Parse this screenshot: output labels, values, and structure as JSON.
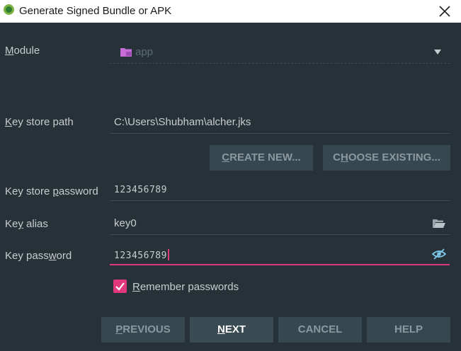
{
  "window": {
    "title": "Generate Signed Bundle or APK"
  },
  "form": {
    "module": {
      "label_pre": "",
      "label_mn": "M",
      "label_post": "odule",
      "value": "app"
    },
    "keystore_path": {
      "label_pre": "",
      "label_mn": "K",
      "label_post": "ey store path",
      "value": "C:\\Users\\Shubham\\alcher.jks"
    },
    "keystore_password": {
      "label_pre": "Key store ",
      "label_mn": "p",
      "label_post": "assword",
      "value": "123456789"
    },
    "key_alias": {
      "label_pre": "Ke",
      "label_mn": "y",
      "label_post": " alias",
      "value": "key0"
    },
    "key_password": {
      "label_pre": "Key pass",
      "label_mn": "w",
      "label_post": "ord",
      "value": "123456789"
    },
    "remember": {
      "label_pre": "",
      "label_mn": "R",
      "label_post": "emember passwords",
      "checked": true
    }
  },
  "buttons": {
    "create_new": {
      "mn": "C",
      "rest": "REATE NEW..."
    },
    "choose_existing": {
      "pre": "C",
      "mn": "H",
      "rest": "OOSE EXISTING..."
    },
    "previous": {
      "mn": "P",
      "rest": "REVIOUS"
    },
    "next": {
      "mn": "N",
      "rest": "EXT"
    },
    "cancel": "CANCEL",
    "help": "HELP"
  },
  "icons": {
    "module": "folder-app-icon",
    "alias": "folder-open-icon",
    "password_visibility": "eye-hidden-icon",
    "close": "close-icon"
  },
  "colors": {
    "background": "#263238",
    "accent": "#e0387a",
    "button_bg": "#37474f"
  }
}
